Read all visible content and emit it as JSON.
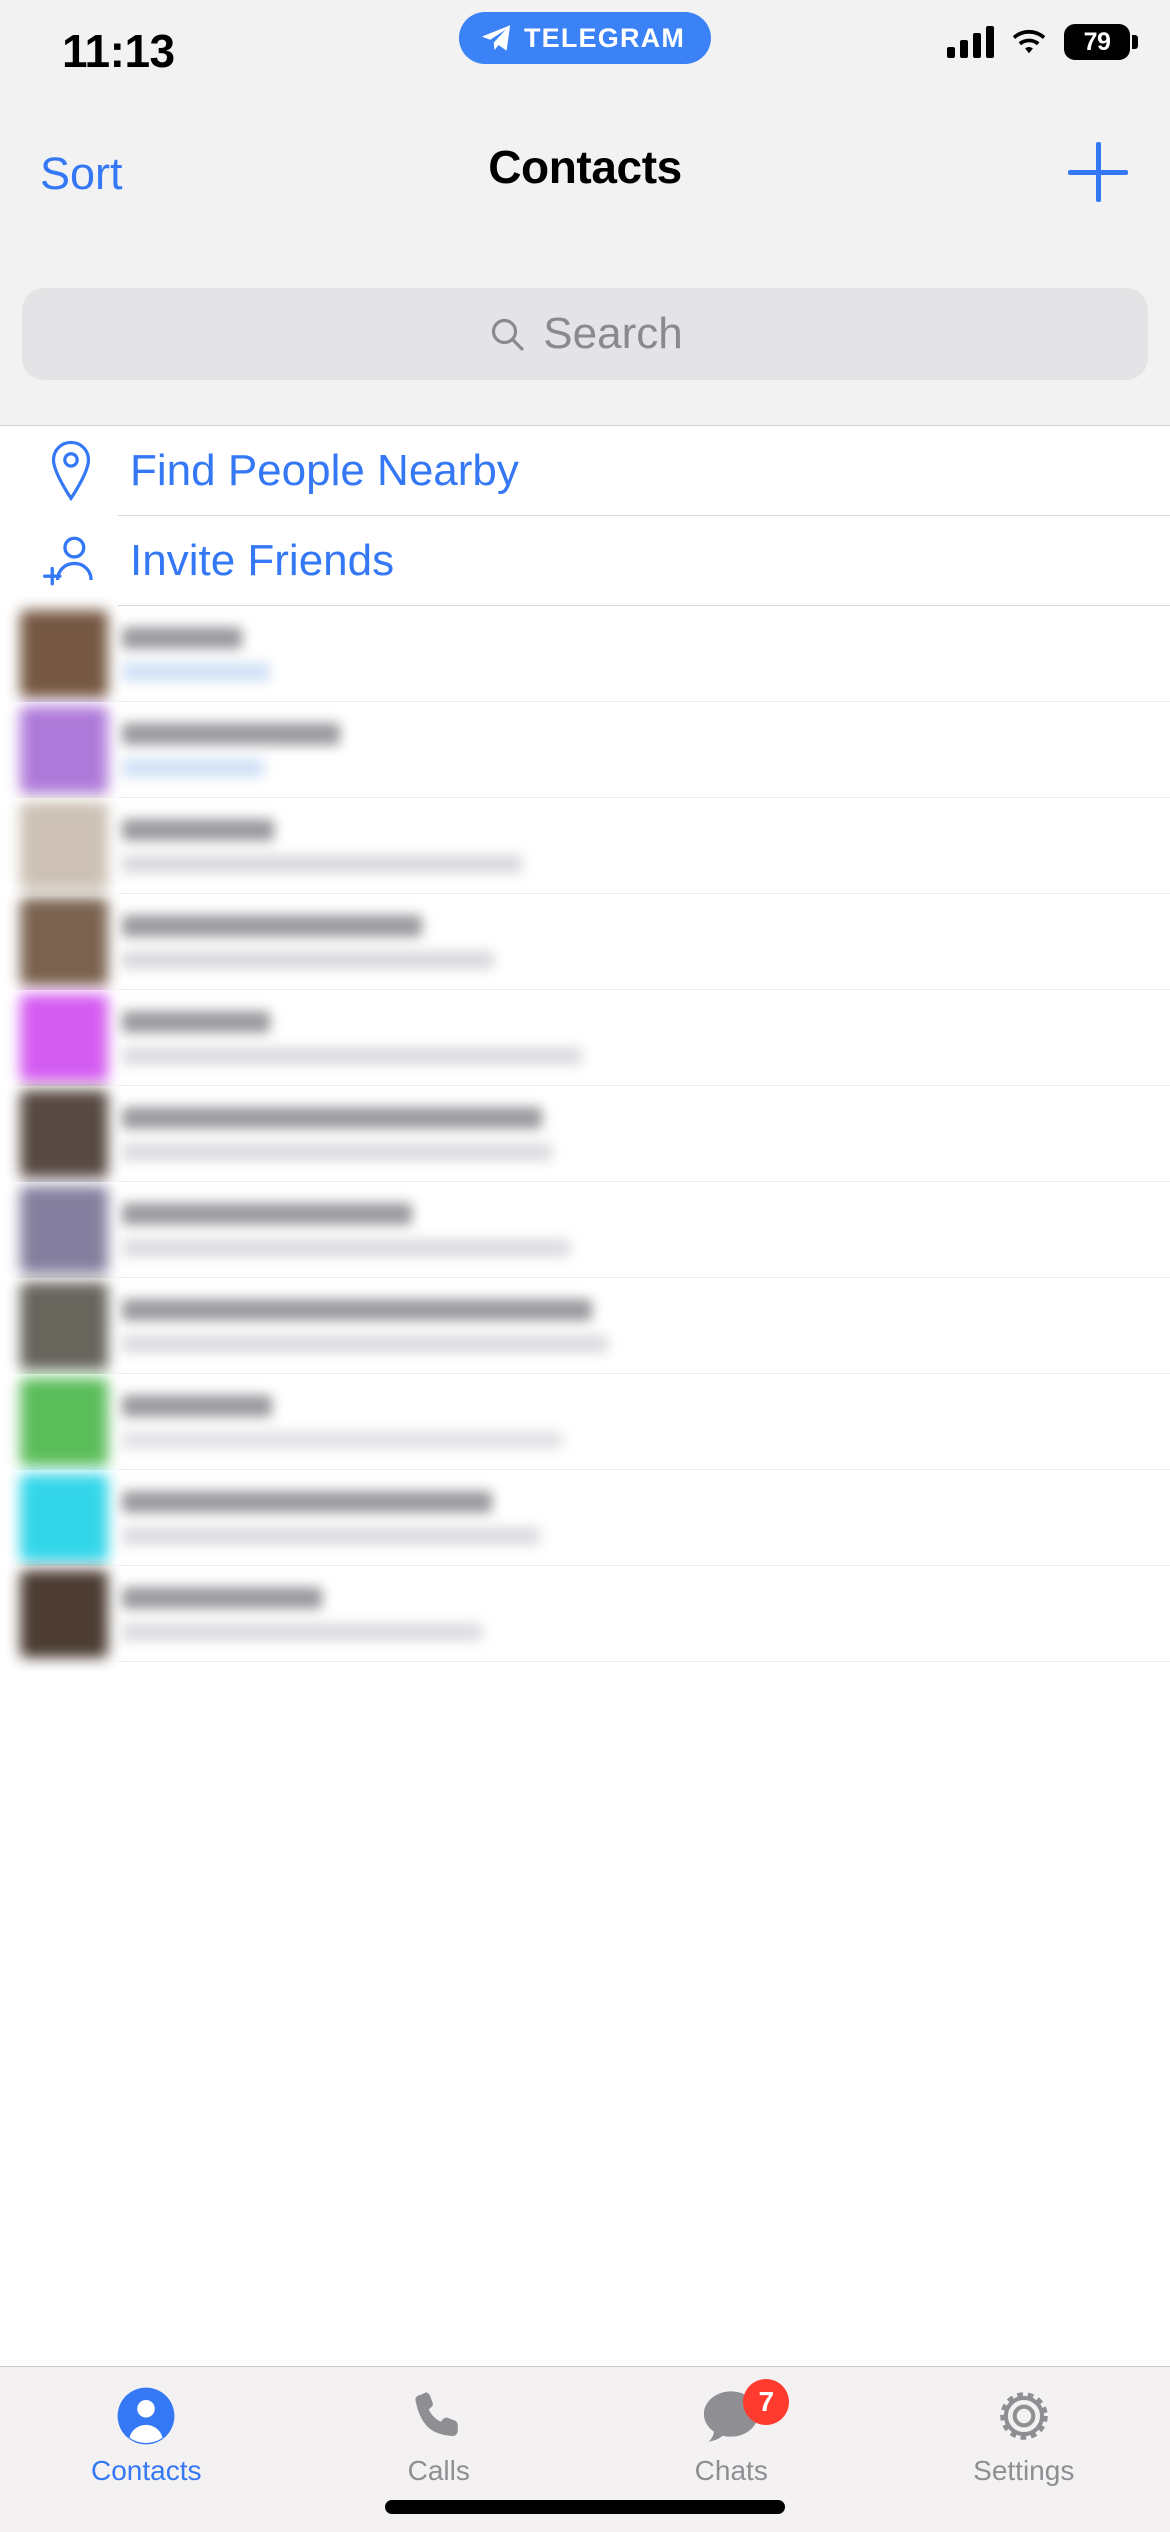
{
  "status_bar": {
    "time": "11:13",
    "app_pill_label": "TELEGRAM",
    "battery_level": "79",
    "icons": [
      "telegram-plane-icon",
      "cellular-signal-icon",
      "wifi-icon",
      "battery-icon"
    ]
  },
  "nav_bar": {
    "left_button": "Sort",
    "title": "Contacts",
    "right_button_icon": "plus-icon"
  },
  "search": {
    "placeholder": "Search",
    "value": "",
    "icon": "search-icon"
  },
  "actions": [
    {
      "label": "Find People Nearby",
      "icon": "location-pin-icon"
    },
    {
      "label": "Invite Friends",
      "icon": "person-add-icon"
    }
  ],
  "contacts_note": "Contact list rows are pixelated/redacted in the screenshot; names and statuses are not legible.",
  "contacts": [
    {
      "avatar_color": "#6b4a33",
      "name_width": 120,
      "sub_width": 148,
      "sub_color": "#cfe0f5"
    },
    {
      "avatar_color": "#a86fd6",
      "name_width": 218,
      "sub_width": 142,
      "sub_color": "#cfe0f5"
    },
    {
      "avatar_color": "#c8bcae",
      "name_width": 152,
      "sub_width": 400,
      "sub_color": "#d8d8dc"
    },
    {
      "avatar_color": "#6f5540",
      "name_width": 300,
      "sub_width": 372,
      "sub_color": "#d8d8dc"
    },
    {
      "avatar_color": "#d14ff0",
      "name_width": 148,
      "sub_width": 460,
      "sub_color": "#dcdce0"
    },
    {
      "avatar_color": "#4a3a32",
      "name_width": 420,
      "sub_width": 430,
      "sub_color": "#dcdce0"
    },
    {
      "avatar_color": "#7a7596",
      "name_width": 290,
      "sub_width": 448,
      "sub_color": "#dcdce0"
    },
    {
      "avatar_color": "#5b584f",
      "name_width": 470,
      "sub_width": 486,
      "sub_color": "#dcdce0"
    },
    {
      "avatar_color": "#4db84d",
      "name_width": 150,
      "sub_width": 440,
      "sub_color": "#e2e2e6"
    },
    {
      "avatar_color": "#22d3e8",
      "name_width": 370,
      "sub_width": 418,
      "sub_color": "#dcdce0"
    },
    {
      "avatar_color": "#3d2c22",
      "name_width": 200,
      "sub_width": 360,
      "sub_color": "#dcdce0"
    }
  ],
  "partial_text": "last seen 10 minutes ago",
  "tab_bar": {
    "tabs": [
      {
        "label": "Contacts",
        "icon": "person-filled-icon",
        "active": true,
        "badge": ""
      },
      {
        "label": "Calls",
        "icon": "phone-icon",
        "active": false,
        "badge": ""
      },
      {
        "label": "Chats",
        "icon": "chat-bubble-icon",
        "active": false,
        "badge": "7"
      },
      {
        "label": "Settings",
        "icon": "gear-icon",
        "active": false,
        "badge": ""
      }
    ]
  },
  "colors": {
    "accent_blue": "#3478f6",
    "pill_blue": "#3b82f6",
    "badge_red": "#ff3b30",
    "inactive_gray": "#8e8e93",
    "chrome_gray": "#f2f2f2",
    "search_field": "#e4e4e6"
  }
}
